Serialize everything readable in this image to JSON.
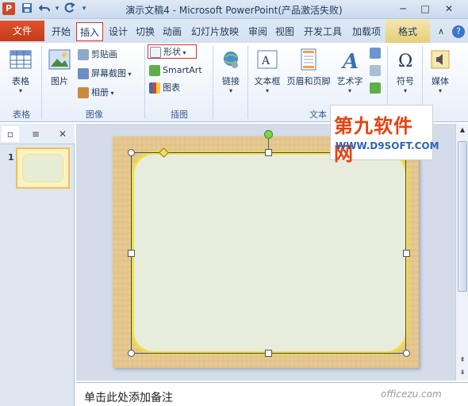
{
  "titlebar": {
    "app_icon": "P",
    "title": "演示文稿4 - Microsoft PowerPoint(产品激活失败)",
    "save_icon": "save-icon",
    "undo_icon": "undo-icon",
    "redo_icon": "redo-icon",
    "qat_more": "▾",
    "minimize": "─",
    "maximize": "□",
    "close": "✕"
  },
  "tabs": {
    "file": "文件",
    "items": [
      "开始",
      "插入",
      "设计",
      "切换",
      "动画",
      "幻灯片放映",
      "审阅",
      "视图",
      "开发工具",
      "加载项"
    ],
    "context_tab": "格式",
    "active": "插入",
    "collapse": "∧",
    "help": "?"
  },
  "ribbon": {
    "table": {
      "label": "表格",
      "group": "表格"
    },
    "images": {
      "picture": "图片",
      "clipart": "剪贴画",
      "screenshot": "屏幕截图",
      "album": "相册",
      "group": "图像"
    },
    "illustrations": {
      "shapes": "形状",
      "smartart": "SmartArt",
      "chart": "图表",
      "group": "插图"
    },
    "links": {
      "link": "链接"
    },
    "text": {
      "textbox": "文本框",
      "header_footer": "页眉和页脚",
      "wordart": "艺术字",
      "group": "文本"
    },
    "symbols": {
      "symbol": "符号"
    },
    "media": {
      "media": "媒体"
    }
  },
  "watermark": {
    "main": "第九软件网",
    "sub": "WWW.D9SOFT.COM"
  },
  "panel": {
    "slide_number": "1"
  },
  "notes": {
    "placeholder": "单击此处添加备注"
  },
  "footer_watermark": "officezu.com",
  "colors": {
    "accent": "#2b579a",
    "file_tab": "#d24726",
    "highlight": "#e03030",
    "slide_bg": "#e6c993",
    "shape_fill": "#e8ecdc",
    "shape_glow": "#f6f800"
  }
}
